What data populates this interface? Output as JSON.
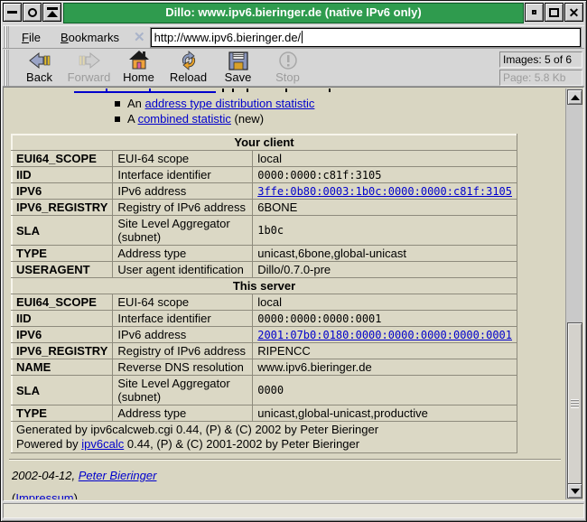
{
  "window": {
    "title": "Dillo: www.ipv6.bieringer.de (native IPv6 only)"
  },
  "menu": {
    "file_label": "ile",
    "file_initial": "F",
    "bookmarks_label": "ookmarks",
    "bookmarks_initial": "B",
    "url_value": "http://www.ipv6.bieringer.de/"
  },
  "toolbar": {
    "back_label": "Back",
    "forward_label": "Forward",
    "home_label": "Home",
    "reload_label": "Reload",
    "save_label": "Save",
    "stop_label": "Stop",
    "images_info": "Images: 5 of 6",
    "page_info": "Page: 5.8 Kb"
  },
  "bullets": {
    "item1_prefix": "An ",
    "item1_link": "address type distribution statistic",
    "item2_prefix": "A ",
    "item2_link": "combined statistic",
    "item2_suffix": " (new)"
  },
  "client": {
    "header": "Your client",
    "rows": [
      {
        "k": "EUI64_SCOPE",
        "d": "EUI-64 scope",
        "v": "local"
      },
      {
        "k": "IID",
        "d": "Interface identifier",
        "v": "0000:0000:c81f:3105"
      },
      {
        "k": "IPV6",
        "d": "IPv6 address",
        "v": "3ffe:0b80:0003:1b0c:0000:0000:c81f:3105"
      },
      {
        "k": "IPV6_REGISTRY",
        "d": "Registry of IPv6 address",
        "v": "6BONE"
      },
      {
        "k": "SLA",
        "d": "Site Level Aggregator (subnet)",
        "v": "1b0c"
      },
      {
        "k": "TYPE",
        "d": "Address type",
        "v": "unicast,6bone,global-unicast"
      },
      {
        "k": "USERAGENT",
        "d": "User agent identification",
        "v": "Dillo/0.7.0-pre"
      }
    ]
  },
  "server": {
    "header": "This server",
    "rows": [
      {
        "k": "EUI64_SCOPE",
        "d": "EUI-64 scope",
        "v": "local"
      },
      {
        "k": "IID",
        "d": "Interface identifier",
        "v": "0000:0000:0000:0001"
      },
      {
        "k": "IPV6",
        "d": "IPv6 address",
        "v": "2001:07b0:0180:0000:0000:0000:0000:0001"
      },
      {
        "k": "IPV6_REGISTRY",
        "d": "Registry of IPv6 address",
        "v": "RIPENCC"
      },
      {
        "k": "NAME",
        "d": "Reverse DNS resolution",
        "v": "www.ipv6.bieringer.de"
      },
      {
        "k": "SLA",
        "d": "Site Level Aggregator (subnet)",
        "v": "0000"
      },
      {
        "k": "TYPE",
        "d": "Address type",
        "v": "unicast,global-unicast,productive"
      }
    ]
  },
  "table_footer": {
    "line1": "Generated by ipv6calcweb.cgi 0.44, (P) & (C) 2002 by Peter Bieringer",
    "line2_prefix": "Powered by ",
    "line2_link": "ipv6calc",
    "line2_suffix": " 0.44, (P) & (C) 2001-2002 by Peter Bieringer"
  },
  "footer": {
    "date_prefix": "2002-04-12, ",
    "date_link": "Peter Bieringer",
    "impressum_open": "(",
    "impressum_link": "Impressum",
    "impressum_close": ")"
  },
  "colors": {
    "titlebar_green": "#2f9b4e",
    "link_blue": "#0000cc",
    "page_beige": "#d9d6c2"
  }
}
